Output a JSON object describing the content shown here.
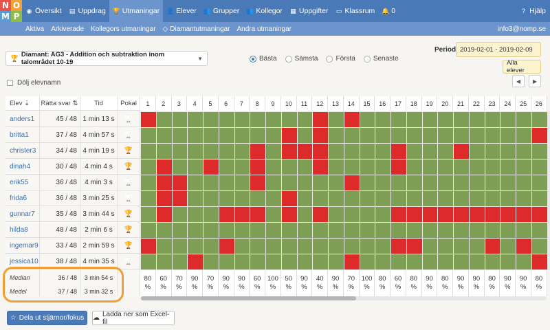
{
  "logo": {
    "letters": [
      "N",
      "O",
      "M",
      "P"
    ],
    "colors": [
      "#e8524a",
      "#f1a33a",
      "#5a9bd5",
      "#8bbd4a"
    ]
  },
  "nav": {
    "items": [
      {
        "label": "Översikt",
        "icon": "dashboard-icon"
      },
      {
        "label": "Uppdrag",
        "icon": "book-icon"
      },
      {
        "label": "Utmaningar",
        "icon": "trophy-icon",
        "active": true
      },
      {
        "label": "Elever",
        "icon": "user-icon"
      },
      {
        "label": "Grupper",
        "icon": "users-icon"
      },
      {
        "label": "Kollegor",
        "icon": "colleagues-icon"
      },
      {
        "label": "Uppgifter",
        "icon": "grid-icon"
      },
      {
        "label": "Klassrum",
        "icon": "blackboard-icon"
      },
      {
        "label": "0",
        "icon": "bell-icon"
      }
    ],
    "help_label": "Hjälp"
  },
  "subnav": {
    "items": [
      "Aktiva",
      "Arkiverade",
      "Kollegors utmaningar",
      "Diamantutmaningar",
      "Andra utmaningar"
    ],
    "user_email": "info3@nomp.se"
  },
  "controls": {
    "problem": "Diamant: AG3 - Addition och subtraktion inom talområdet 10-19",
    "radios": [
      {
        "label": "Bästa",
        "checked": true
      },
      {
        "label": "Sämsta",
        "checked": false
      },
      {
        "label": "Första",
        "checked": false
      },
      {
        "label": "Senaste",
        "checked": false
      }
    ],
    "period_label": "Period",
    "period_value": "2019-02-01 - 2019-02-09",
    "students_value": "Alla elever",
    "hide_names_label": "Dölj elevnamn"
  },
  "table": {
    "headers": {
      "student": "Elev",
      "correct": "Rätta svar",
      "time": "Tid",
      "cup": "Pokal"
    },
    "question_numbers": [
      "1",
      "2",
      "3",
      "4",
      "5",
      "6",
      "7",
      "8",
      "9",
      "10",
      "11",
      "12",
      "13",
      "14",
      "15",
      "16",
      "17",
      "18",
      "19",
      "20",
      "21",
      "22",
      "23",
      "24",
      "25",
      "26"
    ],
    "rows": [
      {
        "name": "anders1",
        "correct": "45 / 48",
        "time": "1 min 13 s",
        "trophy": "silver",
        "wrong": [
          1,
          12,
          14
        ]
      },
      {
        "name": "britta1",
        "correct": "37 / 48",
        "time": "4 min 57 s",
        "trophy": "silver",
        "wrong": [
          10,
          12,
          26
        ]
      },
      {
        "name": "christer3",
        "correct": "34 / 48",
        "time": "4 min 19 s",
        "trophy": "gold",
        "wrong": [
          8,
          10,
          11,
          12,
          17,
          21
        ]
      },
      {
        "name": "dinah4",
        "correct": "30 / 48",
        "time": "4 min 4 s",
        "trophy": "gold",
        "wrong": [
          2,
          5,
          8,
          12,
          17
        ]
      },
      {
        "name": "erik55",
        "correct": "36 / 48",
        "time": "4 min 3 s",
        "trophy": "silver",
        "wrong": [
          2,
          3,
          8,
          14
        ]
      },
      {
        "name": "frida6",
        "correct": "36 / 48",
        "time": "3 min 25 s",
        "trophy": "silver",
        "wrong": [
          2,
          3,
          10
        ]
      },
      {
        "name": "gunnar7",
        "correct": "35 / 48",
        "time": "3 min 44 s",
        "trophy": "gold",
        "wrong": [
          2,
          6,
          7,
          8,
          10,
          12,
          17,
          18,
          19,
          20,
          21,
          22,
          23,
          24,
          25,
          26
        ]
      },
      {
        "name": "hilda8",
        "correct": "48 / 48",
        "time": "2 min 6 s",
        "trophy": "gold",
        "wrong": []
      },
      {
        "name": "ingemar9",
        "correct": "33 / 48",
        "time": "2 min 59 s",
        "trophy": "gold",
        "wrong": [
          1,
          6,
          17,
          18,
          23,
          25
        ]
      },
      {
        "name": "jessica10",
        "correct": "38 / 48",
        "time": "4 min 35 s",
        "trophy": "silver",
        "wrong": [
          4,
          14,
          26
        ]
      }
    ],
    "median": {
      "label": "Median",
      "correct": "36 / 48",
      "time": "3 min 54 s"
    },
    "mean": {
      "label": "Medel",
      "correct": "37 / 48",
      "time": "3 min 32 s"
    },
    "percent_values": [
      "80",
      "60",
      "70",
      "90",
      "70",
      "90",
      "90",
      "60",
      "100",
      "50",
      "90",
      "40",
      "90",
      "70",
      "100",
      "80",
      "60",
      "80",
      "90",
      "80",
      "90",
      "90",
      "80",
      "90",
      "90",
      "80"
    ],
    "percent_sign": "%"
  },
  "buttons": {
    "share": "Dela ut stjärnor/fokus",
    "download": "Ladda ner som Excel-fil"
  },
  "colors": {
    "correct": "#7f9e55",
    "wrong": "#dd2a2a",
    "nav": "#4a79b8",
    "subnav": "#6b95cc",
    "highlight": "#f0a033"
  }
}
